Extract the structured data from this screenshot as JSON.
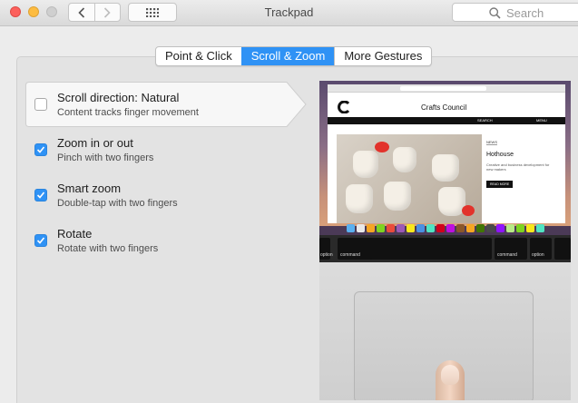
{
  "window": {
    "title": "Trackpad",
    "search_placeholder": "Search"
  },
  "tabs": [
    {
      "label": "Point & Click",
      "active": false
    },
    {
      "label": "Scroll & Zoom",
      "active": true
    },
    {
      "label": "More Gestures",
      "active": false
    }
  ],
  "options": [
    {
      "title": "Scroll direction: Natural",
      "subtitle": "Content tracks finger movement",
      "checked": false,
      "selected": true
    },
    {
      "title": "Zoom in or out",
      "subtitle": "Pinch with two fingers",
      "checked": true,
      "selected": false
    },
    {
      "title": "Smart zoom",
      "subtitle": "Double-tap with two fingers",
      "checked": true,
      "selected": false
    },
    {
      "title": "Rotate",
      "subtitle": "Rotate with two fingers",
      "checked": true,
      "selected": false
    }
  ],
  "preview": {
    "site_name": "Crafts Council",
    "nav_search": "SEARCH",
    "nav_menu": "MENU",
    "article_tag": "NEWS",
    "article_title": "Hothouse",
    "article_body": "Creative and business development for new makers",
    "article_button": "READ MORE",
    "keys": {
      "option_left": "option",
      "command_left": "command",
      "command_right": "command",
      "option_right": "option"
    }
  },
  "colors": {
    "accent": "#2f92f5",
    "window_bg": "#ececec",
    "panel_bg": "#e3e3e3"
  }
}
